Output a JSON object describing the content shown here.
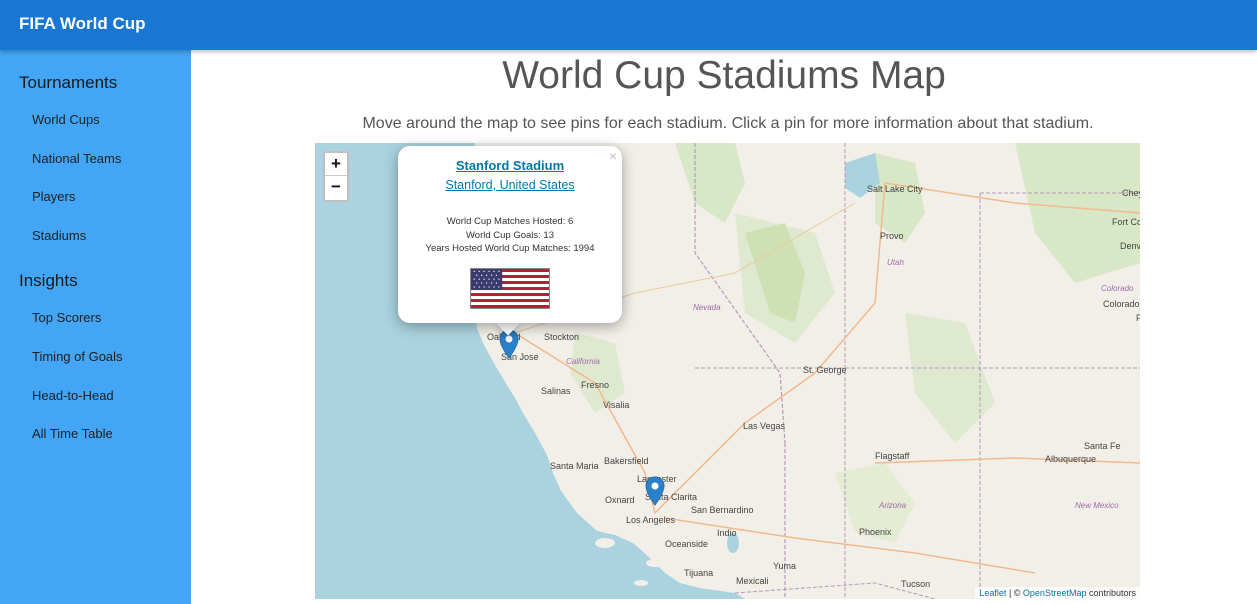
{
  "app": {
    "title": "FIFA World Cup"
  },
  "sidebar": {
    "sections": [
      {
        "title": "Tournaments",
        "items": [
          "World Cups",
          "National Teams",
          "Players",
          "Stadiums"
        ]
      },
      {
        "title": "Insights",
        "items": [
          "Top Scorers",
          "Timing of Goals",
          "Head-to-Head",
          "All Time Table"
        ]
      }
    ]
  },
  "main": {
    "title": "World Cup Stadiums Map",
    "subtitle": "Move around the map to see pins for each stadium. Click a pin for more information about that stadium."
  },
  "map": {
    "zoom_in": "+",
    "zoom_out": "−",
    "labels": {
      "salt_lake_city": "Salt Lake City",
      "provo": "Provo",
      "utah": "Utah",
      "nevada": "Nevada",
      "oakland": "Oakland",
      "stockton": "Stockton",
      "san_jose": "San Jose",
      "california": "California",
      "salinas": "Salinas",
      "fresno": "Fresno",
      "visalia": "Visalia",
      "st_george": "St. George",
      "las_vegas": "Las Vegas",
      "flagstaff": "Flagstaff",
      "santa_fe": "Santa Fe",
      "albuquerque": "Albuquerque",
      "bakersfield": "Bakersfield",
      "santa_maria": "Santa Maria",
      "lancaster": "Lancaster",
      "santa_clarita": "Santa Clarita",
      "oxnard": "Oxnard",
      "san_bernardino": "San Bernardino",
      "los_angeles": "Los Angeles",
      "arizona": "Arizona",
      "new_mexico": "New Mexico",
      "phoenix": "Phoenix",
      "indio": "Indio",
      "oceanside": "Oceanside",
      "yuma": "Yuma",
      "tijuana": "Tijuana",
      "mexicali": "Mexicali",
      "tucson": "Tucson",
      "cheyenne": "Chey",
      "fort_collins": "Fort Col",
      "denver": "Denv",
      "colorado_label": "Colorado",
      "colorado_city": "Colorado",
      "p": "P"
    },
    "attribution": {
      "leaflet": "Leaflet",
      "sep": " | © ",
      "osm": "OpenStreetMap",
      "suffix": " contributors"
    }
  },
  "popup": {
    "close": "×",
    "stadium": "Stanford Stadium",
    "location": "Stanford, United States",
    "matches": "World Cup Matches Hosted: 6",
    "goals": "World Cup Goals: 13",
    "years": "Years Hosted World Cup Matches: 1994",
    "flag_icon": "united-states-flag-icon"
  },
  "colors": {
    "topbar": "#1976d2",
    "sidebar": "#42a5f5",
    "link": "#0078a8",
    "pin": "#2a81cb",
    "water": "#aad3df"
  }
}
